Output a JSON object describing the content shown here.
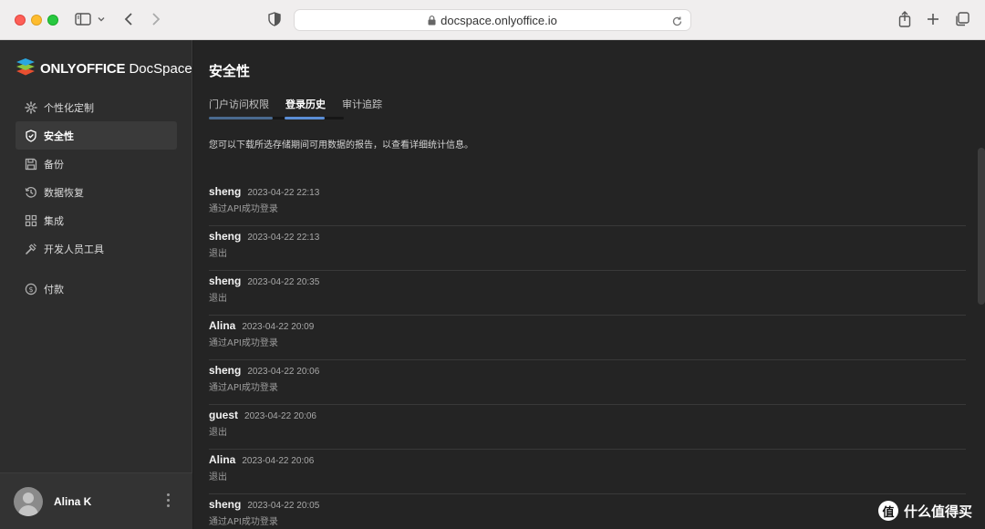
{
  "browser": {
    "url": "docspace.onlyoffice.io"
  },
  "app": {
    "logo_bold": "ONLYOFFICE",
    "logo_rest": " DocSpace"
  },
  "sidebar": {
    "items": [
      {
        "label": "个性化定制",
        "icon": "gear-icon"
      },
      {
        "label": "安全性",
        "icon": "shield-icon"
      },
      {
        "label": "备份",
        "icon": "save-icon"
      },
      {
        "label": "数据恢复",
        "icon": "restore-icon"
      },
      {
        "label": "集成",
        "icon": "grid-icon"
      },
      {
        "label": "开发人员工具",
        "icon": "tools-icon"
      }
    ],
    "extra": {
      "label": "付款",
      "icon": "dollar-icon"
    },
    "active_index": 1
  },
  "user": {
    "name": "Alina K"
  },
  "main": {
    "title": "安全性",
    "tabs": [
      {
        "label": "门户访问权限"
      },
      {
        "label": "登录历史"
      },
      {
        "label": "审计追踪"
      }
    ],
    "description": "您可以下载所选存储期间可用数据的报告，以查看详细统计信息。",
    "entries": [
      {
        "user": "sheng",
        "time": "2023-04-22 22:13",
        "action": "通过API成功登录"
      },
      {
        "user": "sheng",
        "time": "2023-04-22 22:13",
        "action": "退出"
      },
      {
        "user": "sheng",
        "time": "2023-04-22 20:35",
        "action": "退出"
      },
      {
        "user": "Alina",
        "time": "2023-04-22 20:09",
        "action": "通过API成功登录"
      },
      {
        "user": "sheng",
        "time": "2023-04-22 20:06",
        "action": "通过API成功登录"
      },
      {
        "user": "guest",
        "time": "2023-04-22 20:06",
        "action": "退出"
      },
      {
        "user": "Alina",
        "time": "2023-04-22 20:06",
        "action": "退出"
      },
      {
        "user": "sheng",
        "time": "2023-04-22 20:05",
        "action": "通过API成功登录"
      }
    ]
  },
  "watermark": {
    "badge": "值",
    "text": "什么值得买"
  },
  "colors": {
    "accent": "#5b8ed6",
    "sidebar_bg": "#2d2d2d",
    "main_bg": "#242424"
  }
}
